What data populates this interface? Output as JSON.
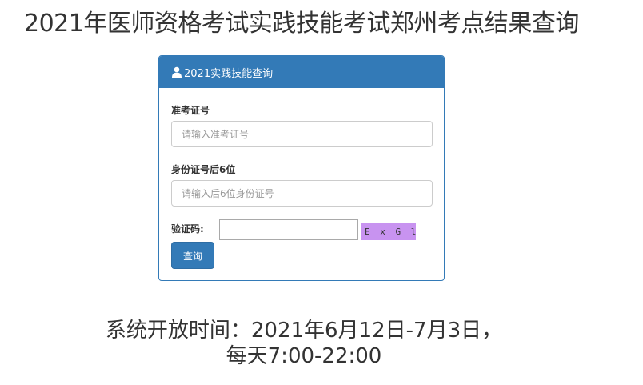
{
  "page": {
    "title": "2021年医师资格考试实践技能考试郑州考点结果查询"
  },
  "panel": {
    "heading": "2021实践技能查询",
    "heading_icon": "user-icon",
    "fields": {
      "ticket_label": "准考证号",
      "ticket_placeholder": "请输入准考证号",
      "id_label": "身份证号后6位",
      "id_placeholder": "请输入后6位身份证号",
      "captcha_label": "验证码:",
      "captcha_value": "",
      "captcha_image_text": "E x G l"
    },
    "query_button": "查询"
  },
  "footer": {
    "line1": "系统开放时间：2021年6月12日-7月3日，",
    "line2": "每天7:00-22:00"
  },
  "colors": {
    "primary": "#337ab7",
    "captcha_bg": "#c893f0"
  }
}
